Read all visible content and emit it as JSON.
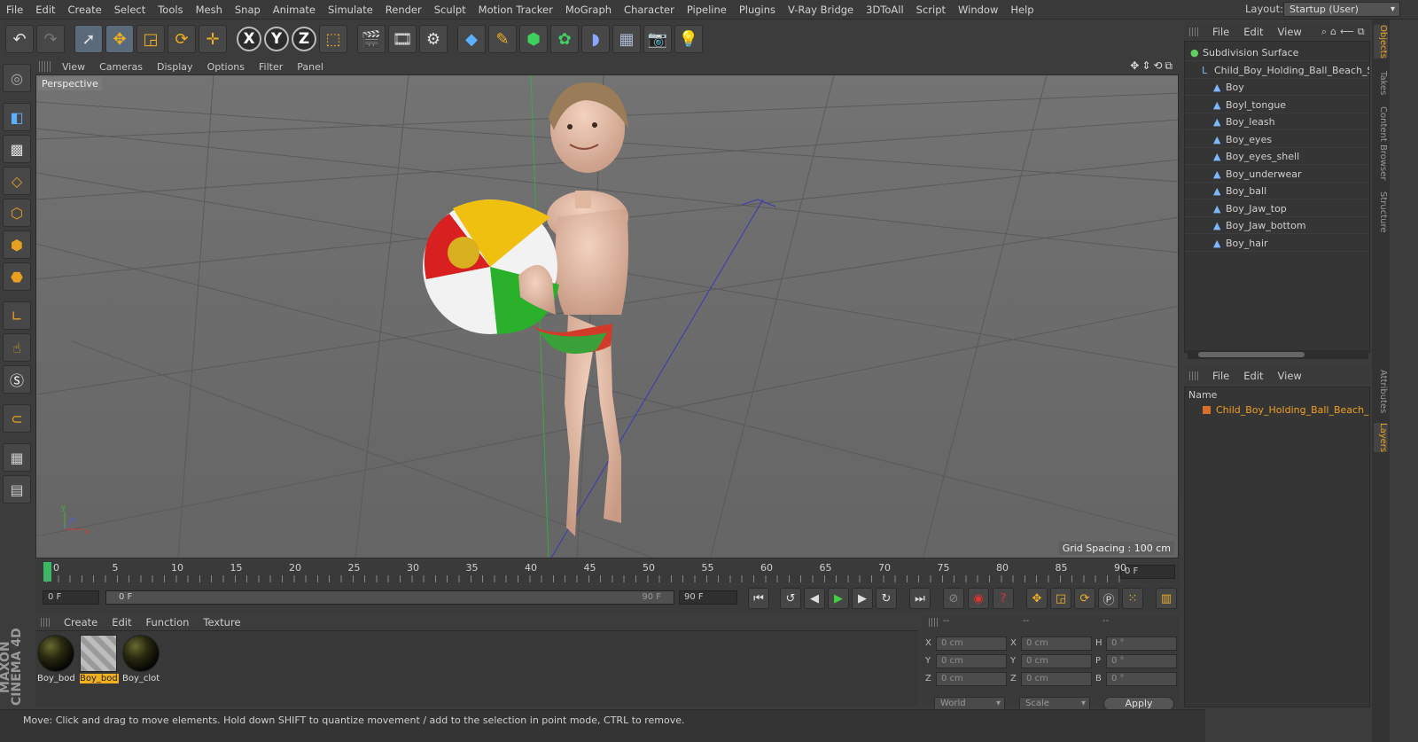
{
  "menubar": [
    "File",
    "Edit",
    "Create",
    "Select",
    "Tools",
    "Mesh",
    "Snap",
    "Animate",
    "Simulate",
    "Render",
    "Sculpt",
    "Motion Tracker",
    "MoGraph",
    "Character",
    "Pipeline",
    "Plugins",
    "V-Ray Bridge",
    "3DToAll",
    "Script",
    "Window",
    "Help"
  ],
  "layout": {
    "label": "Layout:",
    "value": "Startup (User)"
  },
  "toolbar": {
    "axes": [
      "X",
      "Y",
      "Z"
    ]
  },
  "viewport": {
    "menu": [
      "View",
      "Cameras",
      "Display",
      "Options",
      "Filter",
      "Panel"
    ],
    "label": "Perspective",
    "grid_spacing": "Grid Spacing : 100 cm"
  },
  "timeline": {
    "ticks": [
      "0",
      "5",
      "10",
      "15",
      "20",
      "25",
      "30",
      "35",
      "40",
      "45",
      "50",
      "55",
      "60",
      "65",
      "70",
      "75",
      "80",
      "85",
      "90"
    ],
    "end_field": "0 F"
  },
  "transport": {
    "current": "0 F",
    "slider_start": "0 F",
    "slider_end": "90 F",
    "end": "90 F"
  },
  "material_menu": [
    "Create",
    "Edit",
    "Function",
    "Texture"
  ],
  "materials": [
    {
      "name": "Boy_bod",
      "type": "ball",
      "selected": false
    },
    {
      "name": "Boy_bod",
      "type": "check",
      "selected": true
    },
    {
      "name": "Boy_clot",
      "type": "ball",
      "selected": false
    }
  ],
  "brand": "MAXON CINEMA 4D",
  "coords": {
    "headers": [
      "--",
      "--",
      "--"
    ],
    "rows": [
      {
        "a": "X",
        "av": "0 cm",
        "b": "X",
        "bv": "0 cm",
        "c": "H",
        "cv": "0 °"
      },
      {
        "a": "Y",
        "av": "0 cm",
        "b": "Y",
        "bv": "0 cm",
        "c": "P",
        "cv": "0 °"
      },
      {
        "a": "Z",
        "av": "0 cm",
        "b": "Z",
        "bv": "0 cm",
        "c": "B",
        "cv": "0 °"
      }
    ],
    "world": "World",
    "scale": "Scale",
    "apply": "Apply"
  },
  "status": "Move: Click and drag to move elements. Hold down SHIFT to quantize movement / add to the selection in point mode, CTRL to remove.",
  "objects_menu": [
    "File",
    "Edit",
    "View"
  ],
  "objects": [
    {
      "name": "Subdivision Surface",
      "level": 0,
      "kind": "generator"
    },
    {
      "name": "Child_Boy_Holding_Ball_Beach_St",
      "level": 1,
      "kind": "null"
    },
    {
      "name": "Boy",
      "level": 2,
      "kind": "mesh"
    },
    {
      "name": "Boyl_tongue",
      "level": 2,
      "kind": "mesh"
    },
    {
      "name": "Boy_leash",
      "level": 2,
      "kind": "mesh"
    },
    {
      "name": "Boy_eyes",
      "level": 2,
      "kind": "mesh"
    },
    {
      "name": "Boy_eyes_shell",
      "level": 2,
      "kind": "mesh"
    },
    {
      "name": "Boy_underwear",
      "level": 2,
      "kind": "mesh"
    },
    {
      "name": "Boy_ball",
      "level": 2,
      "kind": "mesh"
    },
    {
      "name": "Boy_Jaw_top",
      "level": 2,
      "kind": "mesh"
    },
    {
      "name": "Boy_Jaw_bottom",
      "level": 2,
      "kind": "mesh"
    },
    {
      "name": "Boy_hair",
      "level": 2,
      "kind": "mesh"
    }
  ],
  "layers_menu": [
    "File",
    "Edit",
    "View"
  ],
  "layers": {
    "header": "Name",
    "item": "Child_Boy_Holding_Ball_Beach_St"
  },
  "side_tabs": [
    "Objects",
    "Takes",
    "Content Browser",
    "Structure",
    "Attributes",
    "Layers"
  ]
}
